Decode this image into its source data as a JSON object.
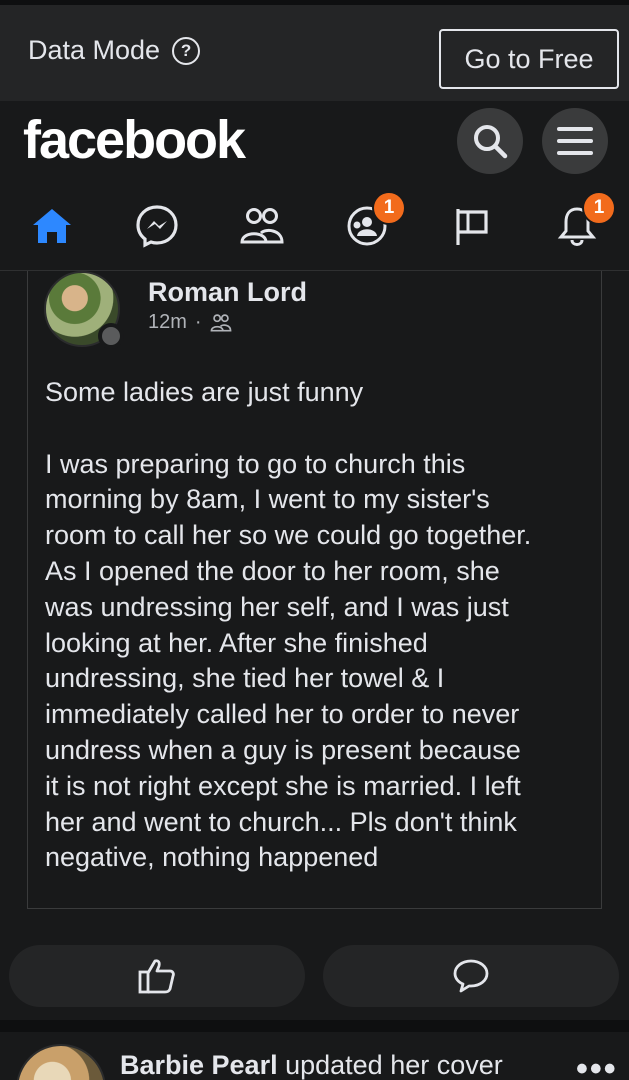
{
  "data_mode": {
    "label": "Data Mode",
    "help_glyph": "?",
    "button_label": "Go to Free"
  },
  "header": {
    "logo": "facebook",
    "search_icon": "search-icon",
    "menu_icon": "menu-icon"
  },
  "nav": {
    "home": {
      "icon": "home-icon",
      "active": true
    },
    "messenger": {
      "icon": "messenger-icon"
    },
    "friends": {
      "icon": "friends-icon"
    },
    "groups": {
      "icon": "groups-icon",
      "badge": "1"
    },
    "pages": {
      "icon": "flag-icon"
    },
    "notifications": {
      "icon": "bell-icon",
      "badge": "1"
    }
  },
  "post": {
    "author": "Roman Lord",
    "time": "12m",
    "separator": "·",
    "audience_icon": "friends-icon",
    "text": "Some ladies are just funny\n\nI was preparing to go to church this\nmorning by 8am, I went to my sister's\nroom to call her so we could go together.\nAs I opened the door to her room, she\nwas undressing her self, and I was just\nlooking at her. After she finished\nundressing, she tied her towel & I\nimmediately called her to order to never\nundress when a guy is present because\nit is not right except she is married. I left\nher and went to church... Pls don't think\nnegative, nothing happened",
    "actions": {
      "like_icon": "like-icon",
      "comment_icon": "comment-icon"
    }
  },
  "next_post": {
    "author": "Barbie Pearl",
    "action_text": " updated her cover",
    "more": "•••"
  },
  "colors": {
    "background": "#18191a",
    "surface": "#242526",
    "accent": "#2d88ff",
    "badge": "#f26b1c"
  }
}
